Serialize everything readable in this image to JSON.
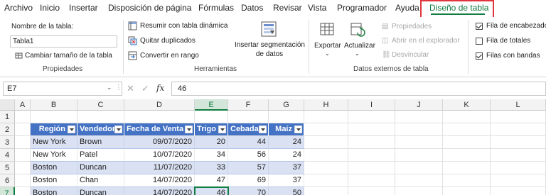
{
  "menu": {
    "items": [
      "Archivo",
      "Inicio",
      "Insertar",
      "Disposición de página",
      "Fórmulas",
      "Datos",
      "Revisar",
      "Vista",
      "Programador",
      "Ayuda",
      "Diseño de tabla"
    ],
    "active": "Diseño de tabla"
  },
  "ribbon": {
    "properties": {
      "name_label": "Nombre de la tabla:",
      "name_value": "Tabla1",
      "resize_label": "Cambiar tamaño de la tabla",
      "group_label": "Propiedades"
    },
    "tools": {
      "pivot_label": "Resumir con tabla dinámica",
      "remove_dup_label": "Quitar duplicados",
      "convert_label": "Convertir en rango",
      "slicer_line1": "Insertar segmentación",
      "slicer_line2": "de datos",
      "group_label": "Herramientas"
    },
    "external": {
      "export_label": "Exportar",
      "refresh_label": "Actualizar",
      "properties_label": "Propiedades",
      "open_browser_label": "Abrir en el explorador",
      "unlink_label": "Desvincular",
      "group_label": "Datos externos de tabla"
    },
    "style_options": {
      "header_row": {
        "label": "Fila de encabezado",
        "checked": true
      },
      "total_row": {
        "label": "Fila de totales",
        "checked": false
      },
      "banded_rows": {
        "label": "Filas con bandas",
        "checked": true
      }
    }
  },
  "formula_bar": {
    "name_box": "E7",
    "fx": "fx",
    "value": "46"
  },
  "grid": {
    "columns": [
      "A",
      "B",
      "C",
      "D",
      "E",
      "F",
      "G",
      "H",
      "I",
      "J",
      "K",
      "L"
    ],
    "rows": [
      "1",
      "2",
      "3",
      "4",
      "5",
      "6",
      "7"
    ],
    "selected_column": "E",
    "selected_row": "7"
  },
  "table": {
    "headers": [
      "Región",
      "Vendedor",
      "Fecha de Venta",
      "Trigo",
      "Cebada",
      "Maíz"
    ],
    "rows": [
      [
        "New York",
        "Brown",
        "09/07/2020",
        "20",
        "44",
        "24"
      ],
      [
        "New York",
        "Patel",
        "10/07/2020",
        "34",
        "56",
        "24"
      ],
      [
        "Boston",
        "Duncan",
        "11/07/2020",
        "33",
        "57",
        "37"
      ],
      [
        "Boston",
        "Chan",
        "14/07/2020",
        "47",
        "69",
        "37"
      ],
      [
        "Boston",
        "Duncan",
        "14/07/2020",
        "46",
        "70",
        "50"
      ]
    ]
  },
  "colors": {
    "accent": "#107c41",
    "table_header": "#4472c4",
    "band": "#d9e1f2",
    "highlight_box": "#e0353d"
  }
}
